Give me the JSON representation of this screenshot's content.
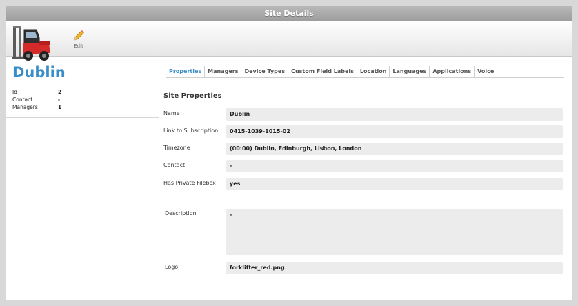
{
  "window": {
    "title": "Site Details"
  },
  "toolbar": {
    "edit_label": "Edit"
  },
  "site": {
    "name": "Dublin",
    "info": [
      {
        "label": "Id",
        "value": "2"
      },
      {
        "label": "Contact",
        "value": "-"
      },
      {
        "label": "Managers",
        "value": "1"
      }
    ]
  },
  "tabs": [
    {
      "label": "Properties",
      "active": true
    },
    {
      "label": "Managers"
    },
    {
      "label": "Device Types"
    },
    {
      "label": "Custom Field Labels"
    },
    {
      "label": "Location"
    },
    {
      "label": "Languages"
    },
    {
      "label": "Applications"
    },
    {
      "label": "Voice"
    }
  ],
  "properties": {
    "title": "Site Properties",
    "fields": {
      "name": {
        "label": "Name",
        "value": "Dublin"
      },
      "subscription": {
        "label": "Link to Subscription",
        "value": "0415-1039-1015-02"
      },
      "timezone": {
        "label": "Timezone",
        "value": "(00:00) Dublin, Edinburgh, Lisbon, London"
      },
      "contact": {
        "label": "Contact",
        "value": "-"
      },
      "filebox": {
        "label": "Has Private Filebox",
        "value": "yes"
      },
      "description": {
        "label": "Description",
        "value": "-"
      },
      "logo": {
        "label": "Logo",
        "value": "forklifter_red.png"
      }
    }
  },
  "colors": {
    "accent": "#3a8ec8",
    "titlebar": "#a8a8a8",
    "field_bg": "#ececec",
    "forklift": "#d42a2a"
  }
}
